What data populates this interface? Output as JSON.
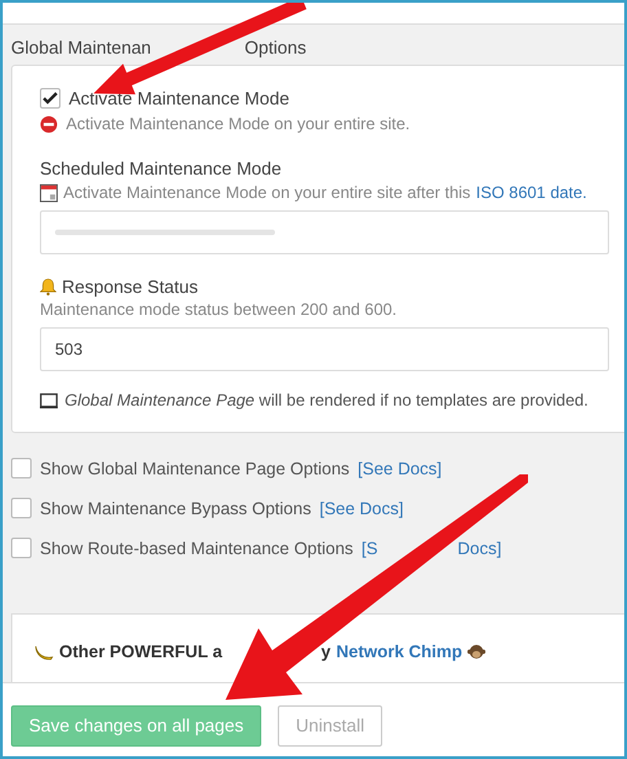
{
  "panel": {
    "title": "Global Maintenan",
    "title_rest": "Options",
    "activate": {
      "label": "Activate Maintenance Mode",
      "checked": true,
      "hint": "Activate Maintenance Mode on your entire site."
    },
    "scheduled": {
      "label": "Scheduled Maintenance Mode",
      "hint": "Activate Maintenance Mode on your entire site after this",
      "link": "ISO 8601 date."
    },
    "response": {
      "label": "Response Status",
      "hint": "Maintenance mode status between 200 and 600.",
      "value": "503"
    },
    "note": "*Global Maintenance Page* will be rendered if no templates are provided."
  },
  "options": [
    {
      "label": "Show Global Maintenance Page Options",
      "link": "[See Docs]",
      "checked": false
    },
    {
      "label": "Show Maintenance Bypass Options",
      "link": "[See Docs]",
      "checked": false
    },
    {
      "label": "Show Route-based Maintenance Options",
      "link": "[S",
      "link_rest": "Docs]",
      "checked": false
    }
  ],
  "promo": {
    "text": "Other POWERFUL a",
    "text_rest": "y",
    "link": "Network Chimp"
  },
  "buttons": [
    {
      "label": "Save changes on all pages",
      "kind": "primary"
    },
    {
      "label": "Uninstall",
      "kind": "secondary"
    }
  ]
}
